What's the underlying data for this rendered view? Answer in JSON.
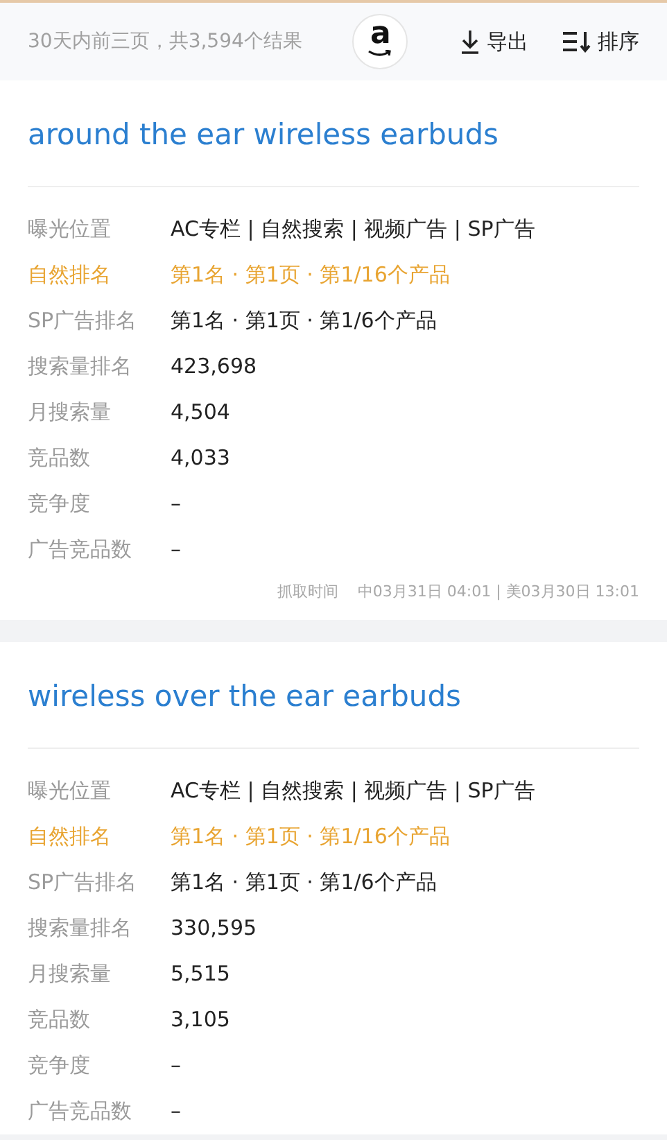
{
  "header": {
    "summary": "30天内前三页，共3,594个结果",
    "logo_letter": "a",
    "actions": [
      {
        "kind": "export",
        "label": "导出"
      },
      {
        "kind": "sort",
        "label": "排序"
      }
    ]
  },
  "keywords": [
    {
      "title": "around the ear wireless earbuds",
      "rows": [
        {
          "label": "曝光位置",
          "value": "AC专栏 | 自然搜索 | 视频广告 | SP广告",
          "highlighted": false
        },
        {
          "label": "自然排名",
          "value": "第1名 · 第1页 · 第1/16个产品",
          "highlighted": true
        },
        {
          "label": "SP广告排名",
          "value": "第1名 · 第1页 · 第1/6个产品",
          "highlighted": false
        },
        {
          "label": "搜索量排名",
          "value": "423,698",
          "highlighted": false
        },
        {
          "label": "月搜索量",
          "value": "4,504",
          "highlighted": false
        },
        {
          "label": "竞品数",
          "value": "4,033",
          "highlighted": false
        },
        {
          "label": "竞争度",
          "value": "–",
          "highlighted": false
        },
        {
          "label": "广告竞品数",
          "value": "–",
          "highlighted": false
        }
      ],
      "fetch_label": "抓取时间",
      "fetch_time": "中03月31日 04:01 | 美03月30日 13:01"
    },
    {
      "title": "wireless over the ear earbuds",
      "rows": [
        {
          "label": "曝光位置",
          "value": "AC专栏 | 自然搜索 | 视频广告 | SP广告",
          "highlighted": false
        },
        {
          "label": "自然排名",
          "value": "第1名 · 第1页 · 第1/16个产品",
          "highlighted": true
        },
        {
          "label": "SP广告排名",
          "value": "第1名 · 第1页 · 第1/6个产品",
          "highlighted": false
        },
        {
          "label": "搜索量排名",
          "value": "330,595",
          "highlighted": false
        },
        {
          "label": "月搜索量",
          "value": "5,515",
          "highlighted": false
        },
        {
          "label": "竞品数",
          "value": "3,105",
          "highlighted": false
        },
        {
          "label": "竞争度",
          "value": "–",
          "highlighted": false
        },
        {
          "label": "广告竞品数",
          "value": "–",
          "highlighted": false
        }
      ]
    }
  ]
}
